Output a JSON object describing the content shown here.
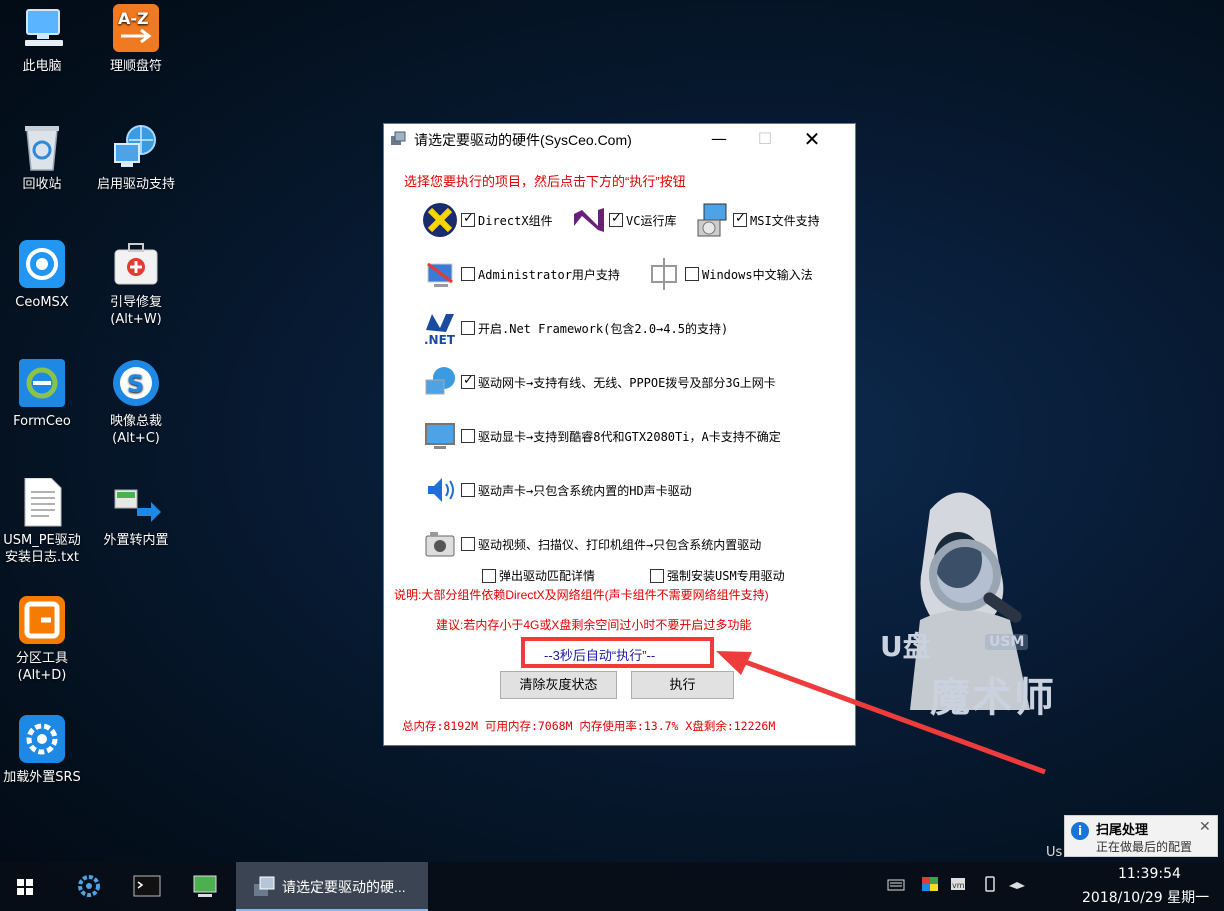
{
  "desktop_icons": [
    {
      "label": "此电脑",
      "icon": "computer-icon"
    },
    {
      "label": "理顺盘符",
      "icon": "az-sort-icon"
    },
    {
      "label": "回收站",
      "icon": "recycle-bin-icon"
    },
    {
      "label": "启用驱动支持",
      "icon": "network-globe-icon"
    },
    {
      "label": "CeoMSX",
      "icon": "ceomsx-icon"
    },
    {
      "label": "引导修复\n(Alt+W)",
      "icon": "first-aid-kit-icon"
    },
    {
      "label": "FormCeo",
      "icon": "formceo-icon"
    },
    {
      "label": "映像总裁\n(Alt+C)",
      "icon": "sysceo-s-icon"
    },
    {
      "label": "USM_PE驱动\n安装日志.txt",
      "icon": "text-file-icon"
    },
    {
      "label": "外置转内置",
      "icon": "transfer-arrow-icon"
    },
    {
      "label": "分区工具\n(Alt+D)",
      "icon": "diskgenius-icon"
    },
    {
      "label": "加载外置SRS",
      "icon": "srs-gear-icon"
    }
  ],
  "brand": {
    "u": "U盘",
    "usm": "USM",
    "magic": "魔术师"
  },
  "dialog": {
    "title": "请选定要驱动的硬件(SysCeo.Com)",
    "heading": "选择您要执行的项目，然后点击下方的“执行”按钮",
    "options": {
      "directx": {
        "label": "DirectX组件",
        "checked": true
      },
      "vc": {
        "label": "VC运行库",
        "checked": true
      },
      "msi": {
        "label": "MSI文件支持",
        "checked": true
      },
      "admin": {
        "label": "Administrator用户支持",
        "checked": false
      },
      "ime": {
        "label": "Windows中文输入法",
        "checked": false
      },
      "dotnet": {
        "label": "开启.Net Framework(包含2.0→4.5的支持)",
        "checked": false
      },
      "network": {
        "label": "驱动网卡→支持有线、无线、PPPOE拨号及部分3G上网卡",
        "checked": true
      },
      "display": {
        "label": "驱动显卡→支持到酷睿8代和GTX2080Ti，A卡支持不确定",
        "checked": false
      },
      "sound": {
        "label": "驱动声卡→只包含系统内置的HD声卡驱动",
        "checked": false
      },
      "video": {
        "label": "驱动视频、扫描仪、打印机组件→只包含系统内置驱动",
        "checked": false
      },
      "popup": {
        "label": "弹出驱动匹配详情",
        "checked": false
      },
      "force_usm": {
        "label": "强制安装USM专用驱动",
        "checked": false
      }
    },
    "note": "说明:大部分组件依赖DirectX及网络组件(声卡组件不需要网络组件支持)",
    "advice": "建议:若内存小于4G或X盘剩余空间过小时不要开启过多功能",
    "countdown": "--3秒后自动“执行”--",
    "btn_clear": "清除灰度状态",
    "btn_exec": "执行",
    "stats": "总内存:8192M  可用内存:7068M  内存使用率:13.7%  X盘剩余:12226M"
  },
  "toast": {
    "title": "扫尾处理",
    "message": "正在做最后的配置",
    "close": "✕"
  },
  "partial_text": "Us",
  "taskbar": {
    "active_window": "请选定要驱动的硬...",
    "time": "11:39:54",
    "date": "2018/10/29 星期一"
  },
  "colors": {
    "accent_red": "#e00000",
    "dialog_border": "#3d7fc8",
    "highlight_box": "#ee3b3b"
  }
}
